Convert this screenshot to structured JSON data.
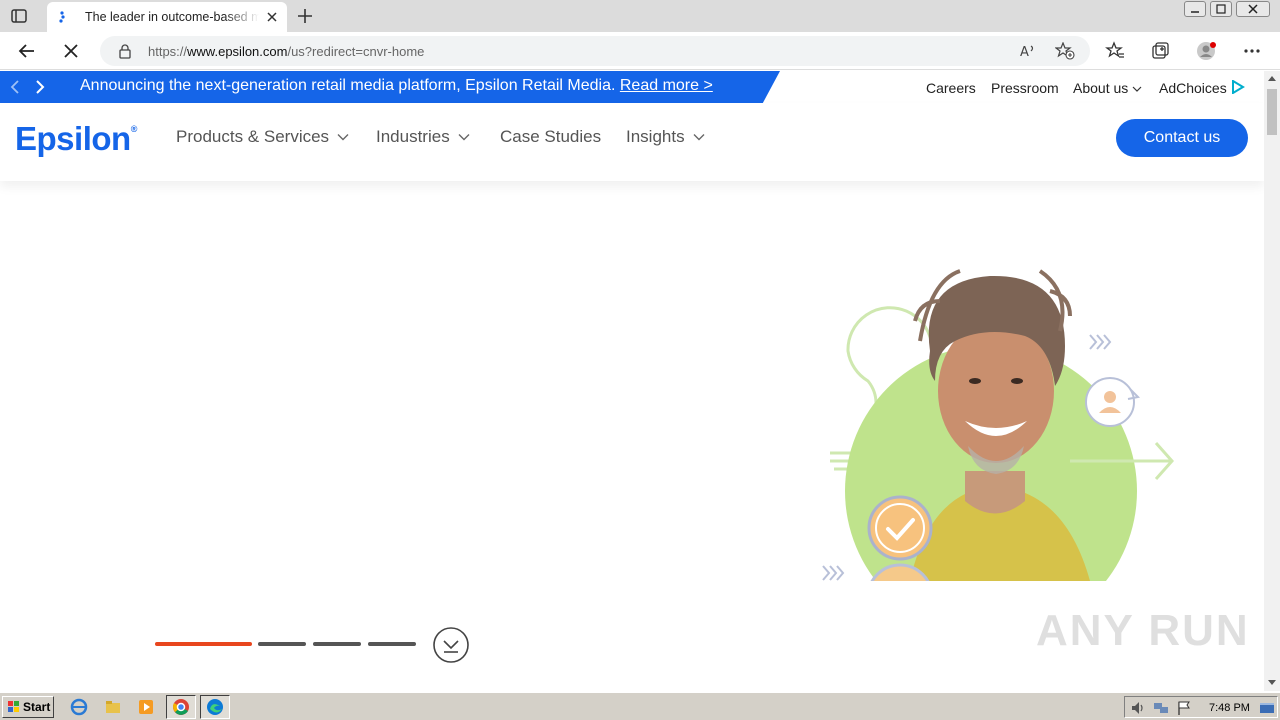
{
  "browser": {
    "tab_title": "The leader in outcome-based ma",
    "url_prefix": "https://",
    "url_host": "www.epsilon.com",
    "url_path": "/us?redirect=cnvr-home"
  },
  "announcement": {
    "text": "Announcing the next-generation retail media platform, Epsilon Retail Media.",
    "link": "Read more >"
  },
  "toplinks": {
    "careers": "Careers",
    "pressroom": "Pressroom",
    "about": "About us",
    "adchoices": "AdChoices"
  },
  "nav": {
    "logo": "Epsilon",
    "products": "Products & Services",
    "industries": "Industries",
    "case_studies": "Case Studies",
    "insights": "Insights",
    "contact": "Contact us"
  },
  "carousel": {
    "slide_count": 4,
    "active_slide": 1,
    "active_color": "#e8461e",
    "inactive_color": "#555555"
  },
  "colors": {
    "brand_blue": "#1565e8"
  },
  "watermark": "ANY RUN",
  "taskbar": {
    "start": "Start",
    "time": "7:48 PM"
  }
}
